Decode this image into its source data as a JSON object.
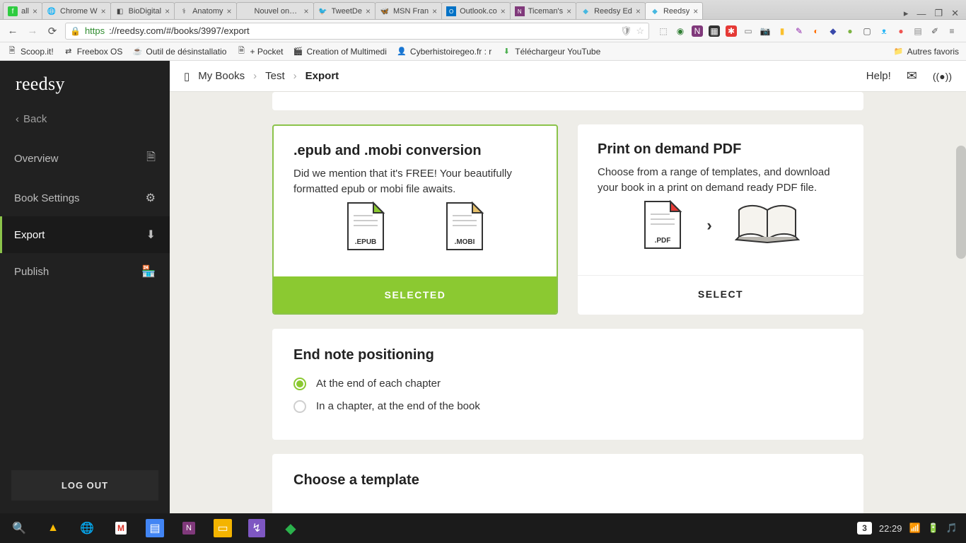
{
  "browser": {
    "tabs": [
      {
        "label": "all"
      },
      {
        "label": "Chrome W"
      },
      {
        "label": "BioDigital"
      },
      {
        "label": "Anatomy"
      },
      {
        "label": "Nouvel onglet"
      },
      {
        "label": "TweetDe"
      },
      {
        "label": "MSN Fran"
      },
      {
        "label": "Outlook.co"
      },
      {
        "label": "Ticeman's"
      },
      {
        "label": "Reedsy Ed"
      },
      {
        "label": "Reedsy"
      }
    ],
    "url_proto": "https",
    "url_rest": "://reedsy.com/#/books/3997/export",
    "bookmarks": [
      "Scoop.it!",
      "Freebox OS",
      "Outil de désinstallatio",
      "+ Pocket",
      "Creation of Multimedi",
      "Cyberhistoiregeo.fr : r",
      "Téléchargeur YouTube"
    ],
    "other_bookmarks": "Autres favoris"
  },
  "sidebar": {
    "logo": "reedsy",
    "back": "Back",
    "items": [
      {
        "label": "Overview"
      },
      {
        "label": "Book Settings"
      },
      {
        "label": "Export"
      },
      {
        "label": "Publish"
      }
    ],
    "logout": "LOG OUT"
  },
  "crumbs": {
    "a": "My Books",
    "b": "Test",
    "c": "Export",
    "help": "Help!"
  },
  "cards": {
    "epub": {
      "title": ".epub and .mobi conversion",
      "desc": "Did we mention that it's FREE! Your beautifully formatted epub or mobi file awaits.",
      "label_epub": ".EPUB",
      "label_mobi": ".MOBI",
      "foot": "SELECTED"
    },
    "pdf": {
      "title": "Print on demand PDF",
      "desc": "Choose from a range of templates, and download your book in a print on demand ready PDF file.",
      "label_pdf": ".PDF",
      "foot": "SELECT"
    }
  },
  "endnote": {
    "title": "End note positioning",
    "opt1": "At the end of each chapter",
    "opt2": "In a chapter, at the end of the book"
  },
  "template": {
    "title": "Choose a template"
  },
  "taskbar": {
    "badge": "3",
    "time": "22:29"
  }
}
